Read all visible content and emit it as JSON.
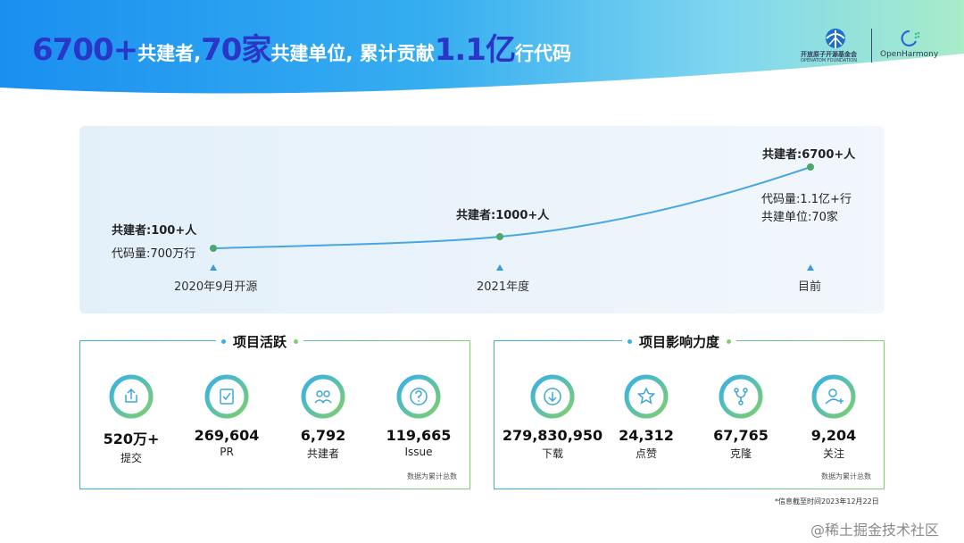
{
  "colors": {
    "title_highlight": "#2a36c8",
    "line": "#49a6e2",
    "point": "#4aa86e",
    "marker": "#3c9be0",
    "ring_start": "#37b0ea",
    "ring_end": "#7fcf6c"
  },
  "title": {
    "n1": "6700+",
    "t1": "共建者,",
    "n2": "70家",
    "t2": "共建单位, 累计贡献",
    "n3": "1.1亿",
    "t3": "行代码"
  },
  "logos": {
    "foundation_cn": "开放原子开源基金会",
    "foundation_en": "OPENATOM FOUNDATION",
    "openharmony": "OpenHarmony"
  },
  "timeline": {
    "milestones": [
      {
        "date": "2020年9月开源",
        "lines": [
          "共建者:100+人",
          "代码量:700万行"
        ]
      },
      {
        "date": "2021年度",
        "lines": [
          "共建者:1000+人"
        ]
      },
      {
        "date": "目前",
        "lines": [
          "共建者:6700+人",
          "代码量:1.1亿+行",
          "共建单位:70家"
        ]
      }
    ]
  },
  "activity": {
    "title": "项目活跃",
    "note": "数据为累计总数",
    "stats": [
      {
        "icon": "upload-icon",
        "value": "520万+",
        "label": "提交"
      },
      {
        "icon": "checklist-icon",
        "value": "269,604",
        "label": "PR"
      },
      {
        "icon": "people-icon",
        "value": "6,792",
        "label": "共建者"
      },
      {
        "icon": "question-icon",
        "value": "119,665",
        "label": "Issue"
      }
    ]
  },
  "influence": {
    "title": "项目影响力度",
    "note": "数据为累计总数",
    "stats": [
      {
        "icon": "download-icon",
        "value": "279,830,950",
        "label": "下载"
      },
      {
        "icon": "star-icon",
        "value": "24,312",
        "label": "点赞"
      },
      {
        "icon": "fork-icon",
        "value": "67,765",
        "label": "克隆"
      },
      {
        "icon": "follow-user-icon",
        "value": "9,204",
        "label": "关注"
      }
    ]
  },
  "footer": {
    "date_note": "*信息截至时间2023年12月22日",
    "watermark": "@稀土掘金技术社区"
  }
}
